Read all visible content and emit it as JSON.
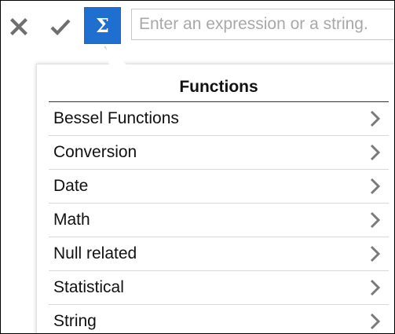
{
  "toolbar": {
    "cancel_icon": "close-icon",
    "accept_icon": "checkmark-icon",
    "functions_icon": "sigma-icon",
    "functions_glyph": "Σ",
    "accent_color": "#1e6fcf",
    "expression": {
      "value": "",
      "placeholder": "Enter an expression or a string."
    }
  },
  "functions_popup": {
    "title": "Functions",
    "items": [
      {
        "label": "Bessel Functions",
        "icon": "chevron-right-icon"
      },
      {
        "label": "Conversion",
        "icon": "chevron-right-icon"
      },
      {
        "label": "Date",
        "icon": "chevron-right-icon"
      },
      {
        "label": "Math",
        "icon": "chevron-right-icon"
      },
      {
        "label": "Null related",
        "icon": "chevron-right-icon"
      },
      {
        "label": "Statistical",
        "icon": "chevron-right-icon"
      },
      {
        "label": "String",
        "icon": "chevron-right-icon"
      }
    ]
  }
}
